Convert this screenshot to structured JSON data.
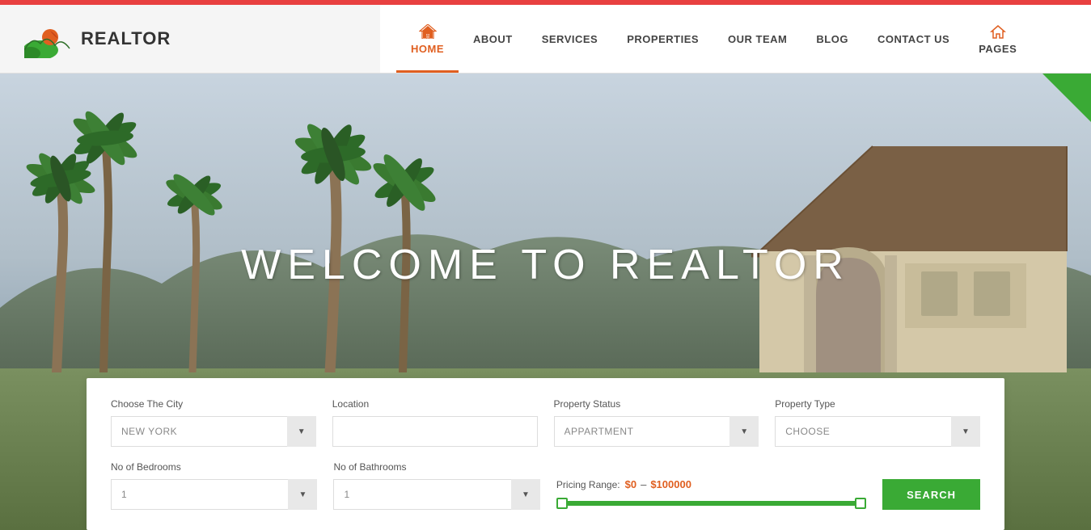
{
  "topbar": {},
  "header": {
    "logo_text": "REALTOR",
    "nav_items": [
      {
        "label": "HOME",
        "active": true,
        "has_icon": true
      },
      {
        "label": "ABOUT",
        "active": false,
        "has_icon": false
      },
      {
        "label": "SERVICES",
        "active": false,
        "has_icon": false
      },
      {
        "label": "PROPERTIES",
        "active": false,
        "has_icon": false
      },
      {
        "label": "OUR TEAM",
        "active": false,
        "has_icon": false
      },
      {
        "label": "BLOG",
        "active": false,
        "has_icon": false
      },
      {
        "label": "CONTACT US",
        "active": false,
        "has_icon": false
      },
      {
        "label": "PAGES",
        "active": false,
        "has_icon": true
      }
    ]
  },
  "hero": {
    "title": "WELCOME TO REALTOR"
  },
  "search": {
    "city_label": "Choose The City",
    "city_value": "NEW YORK",
    "location_label": "Location",
    "location_placeholder": "",
    "status_label": "Property Status",
    "status_value": "APPARTMENT",
    "type_label": "Property Type",
    "type_value": "CHOOSE",
    "bedrooms_label": "No of Bedrooms",
    "bedrooms_value": "1",
    "bathrooms_label": "No of Bathrooms",
    "bathrooms_value": "1",
    "pricing_label": "Pricing Range:",
    "price_min": "$0",
    "price_sep": "–",
    "price_max": "$100000",
    "search_btn": "SEARCH"
  }
}
